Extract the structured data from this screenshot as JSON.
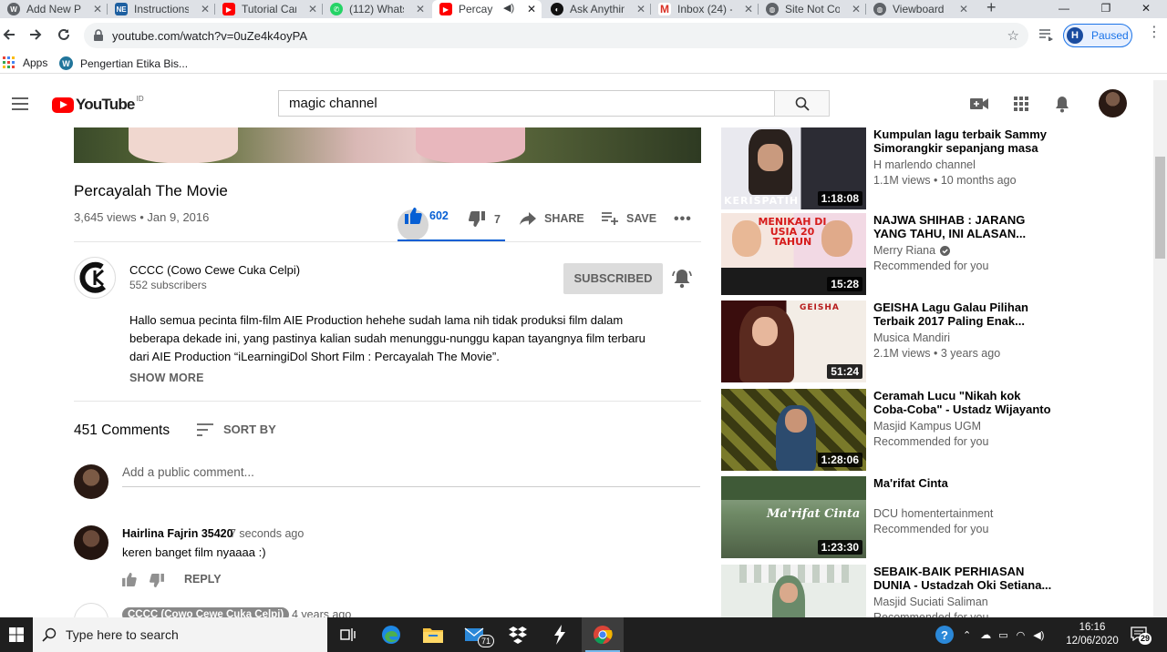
{
  "browser": {
    "tabs": [
      {
        "label": "Add New Po",
        "favicon": "wordpress-icon"
      },
      {
        "label": "Instructions",
        "favicon": "ne-icon"
      },
      {
        "label": "Tutorial Car",
        "favicon": "youtube-icon"
      },
      {
        "label": "(112) Whats",
        "favicon": "whatsapp-icon"
      },
      {
        "label": "Percaya",
        "favicon": "youtube-icon",
        "active": true
      },
      {
        "label": "Ask Anything",
        "favicon": "ask-icon"
      },
      {
        "label": "Inbox (24) -",
        "favicon": "gmail-icon"
      },
      {
        "label": "Site Not Co",
        "favicon": "globe-icon"
      },
      {
        "label": "Viewboard",
        "favicon": "globe-icon"
      }
    ],
    "url": "youtube.com/watch?v=0uZe4k4oyPA",
    "profile": {
      "initial": "H",
      "status": "Paused"
    },
    "bookmarks": [
      {
        "label": "Apps"
      },
      {
        "label": "Pengertian Etika Bis..."
      }
    ]
  },
  "youtube": {
    "logo_text": "YouTube",
    "region": "ID",
    "search_value": "magic channel"
  },
  "video": {
    "title": "Percayalah The Movie",
    "meta": "3,645 views • Jan 9, 2016",
    "likes": "602",
    "dislikes": "7",
    "share_label": "SHARE",
    "save_label": "SAVE",
    "channel_name": "CCCC (Cowo Cewe Cuka Celpi)",
    "subscribers": "552 subscribers",
    "subscribed_label": "SUBSCRIBED",
    "description": "Hallo semua pecinta film-film AIE Production hehehe sudah lama nih tidak produksi film dalam beberapa dekade ini, yang pastinya kalian sudah menunggu-nunggu kapan tayangnya film terbaru dari AIE Production “iLearningiDol Short Film : Percayalah The Movie”.",
    "show_more": "SHOW MORE"
  },
  "comments": {
    "count": "451 Comments",
    "sort_label": "SORT BY",
    "placeholder": "Add a public comment...",
    "items": [
      {
        "author": "Hairlina Fajrin 35420",
        "time": "7 seconds ago",
        "text": "keren banget film nyaaaa :)",
        "reply": "REPLY"
      },
      {
        "author": "CCCC (Cowo Cewe Cuka Celpi)",
        "time": "4 years ago"
      }
    ]
  },
  "recommendations": [
    {
      "title": "Kumpulan lagu terbaik Sammy Simorangkir sepanjang masa",
      "channel": "H marlendo channel",
      "meta": "1.1M views • 10 months ago",
      "duration": "1:18:08",
      "thumb_text": "KERISPATIH"
    },
    {
      "title": "NAJWA SHIHAB : JARANG YANG TAHU, INI ALASAN...",
      "channel": "Merry Riana",
      "verified": true,
      "meta": "Recommended for you",
      "duration": "15:28",
      "thumb_text": "MENIKAH DI USIA 20 TAHUN"
    },
    {
      "title": "GEISHA Lagu Galau Pilihan Terbaik 2017 Paling Enak...",
      "channel": "Musica Mandiri",
      "meta": "2.1M views • 3 years ago",
      "duration": "51:24",
      "thumb_text": "GEISHA"
    },
    {
      "title": "Ceramah Lucu \"Nikah kok Coba-Coba\" - Ustadz Wijayanto",
      "channel": "Masjid Kampus UGM",
      "meta": "Recommended for you",
      "duration": "1:28:06"
    },
    {
      "title": "Ma'rifat Cinta",
      "channel": "DCU homentertainment",
      "meta": "Recommended for you",
      "duration": "1:23:30",
      "thumb_text": "Ma'rifat Cinta"
    },
    {
      "title": "SEBAIK-BAIK PERHIASAN DUNIA - Ustadzah Oki Setiana...",
      "channel": "Masjid Suciati Saliman",
      "meta": "Recommended for you"
    }
  ],
  "taskbar": {
    "search_placeholder": "Type here to search",
    "mail_badge": "71",
    "time": "16:16",
    "date": "12/06/2020",
    "notifications": "29"
  },
  "colors": {
    "youtube_red": "#ff0000",
    "like_blue": "#065fd4",
    "chrome_blue": "#1a73e8"
  }
}
